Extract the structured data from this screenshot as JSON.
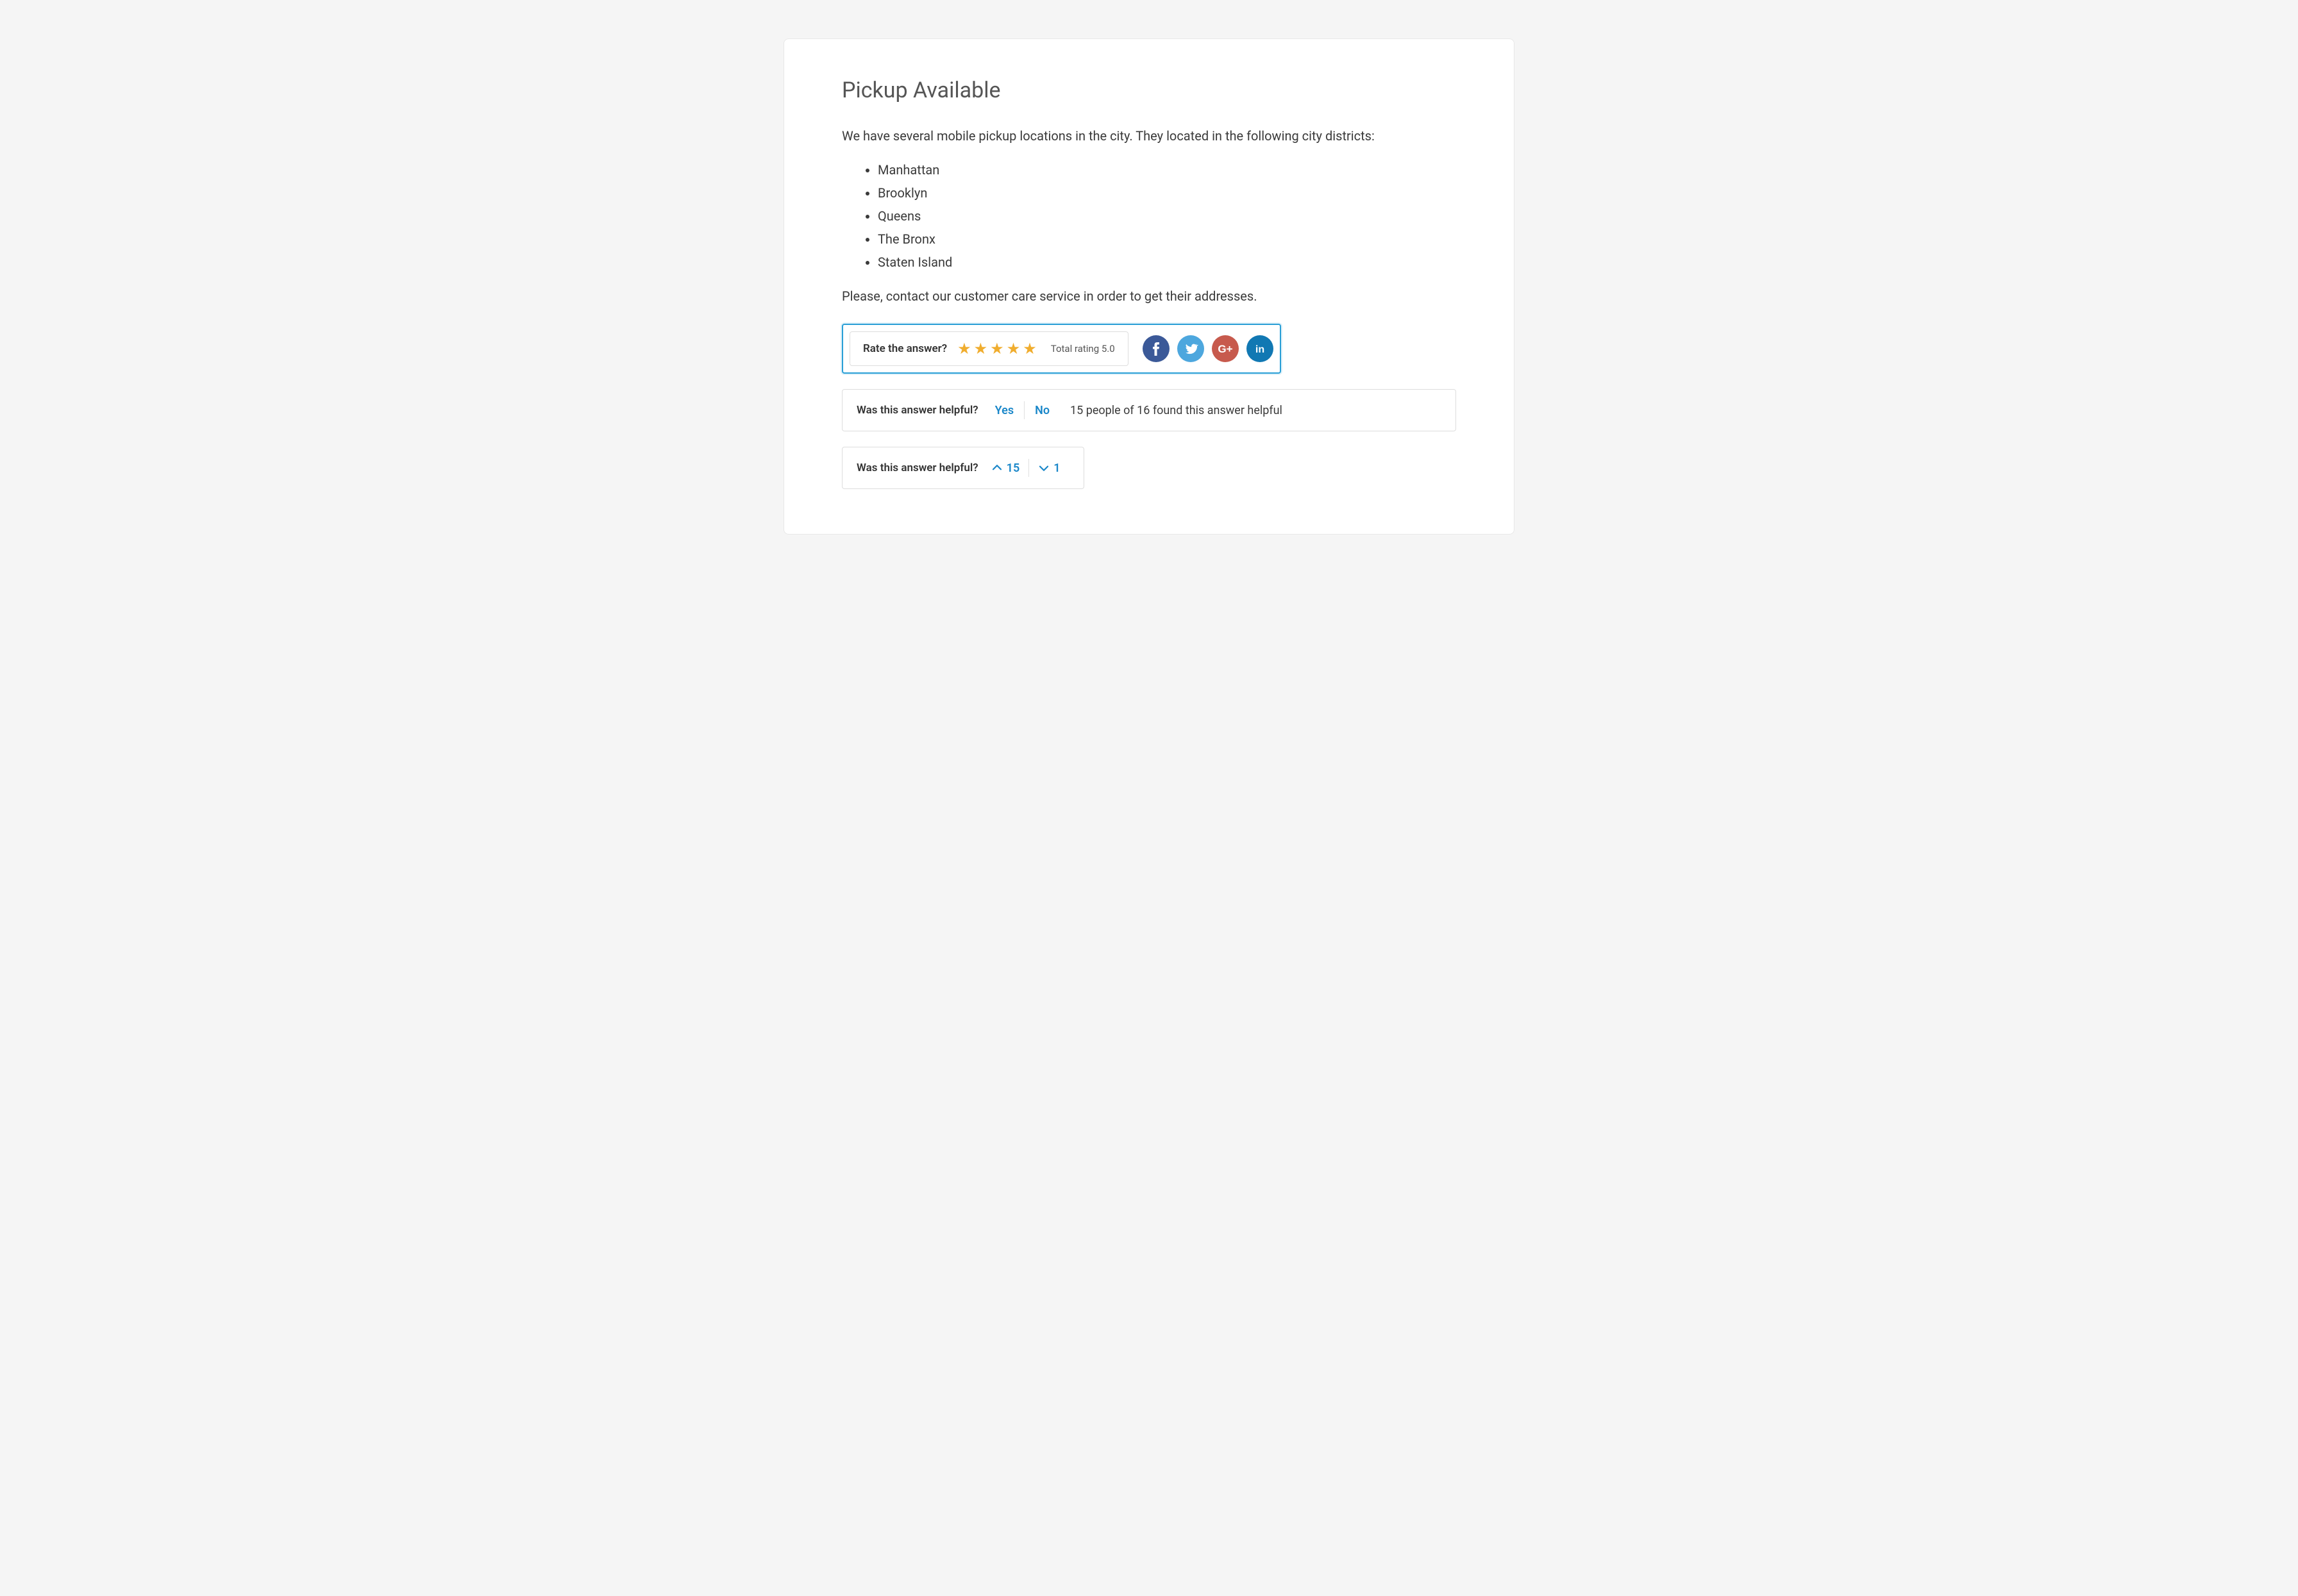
{
  "title": "Pickup Available",
  "intro": "We have several mobile pickup locations in the city. They located in the following city districts:",
  "districts": [
    "Manhattan",
    "Brooklyn",
    "Queens",
    "The Bronx",
    "Staten Island"
  ],
  "outro": "Please, contact our customer care service in order to get their addresses.",
  "rating": {
    "prompt": "Rate the answer?",
    "stars": 5,
    "total_label": "Total rating 5.0"
  },
  "social": {
    "facebook": {
      "name": "facebook",
      "color": "#3b5998"
    },
    "twitter": {
      "name": "twitter",
      "color": "#4da7de"
    },
    "google": {
      "name": "google-plus",
      "color": "#c75a4d"
    },
    "linkedin": {
      "name": "linkedin",
      "color": "#1178b3"
    }
  },
  "helpful": {
    "prompt": "Was this answer helpful?",
    "yes": "Yes",
    "no": "No",
    "summary": "15 people of  16 found this answer helpful"
  },
  "votes": {
    "prompt": "Was this answer helpful?",
    "up": "15",
    "down": "1"
  }
}
